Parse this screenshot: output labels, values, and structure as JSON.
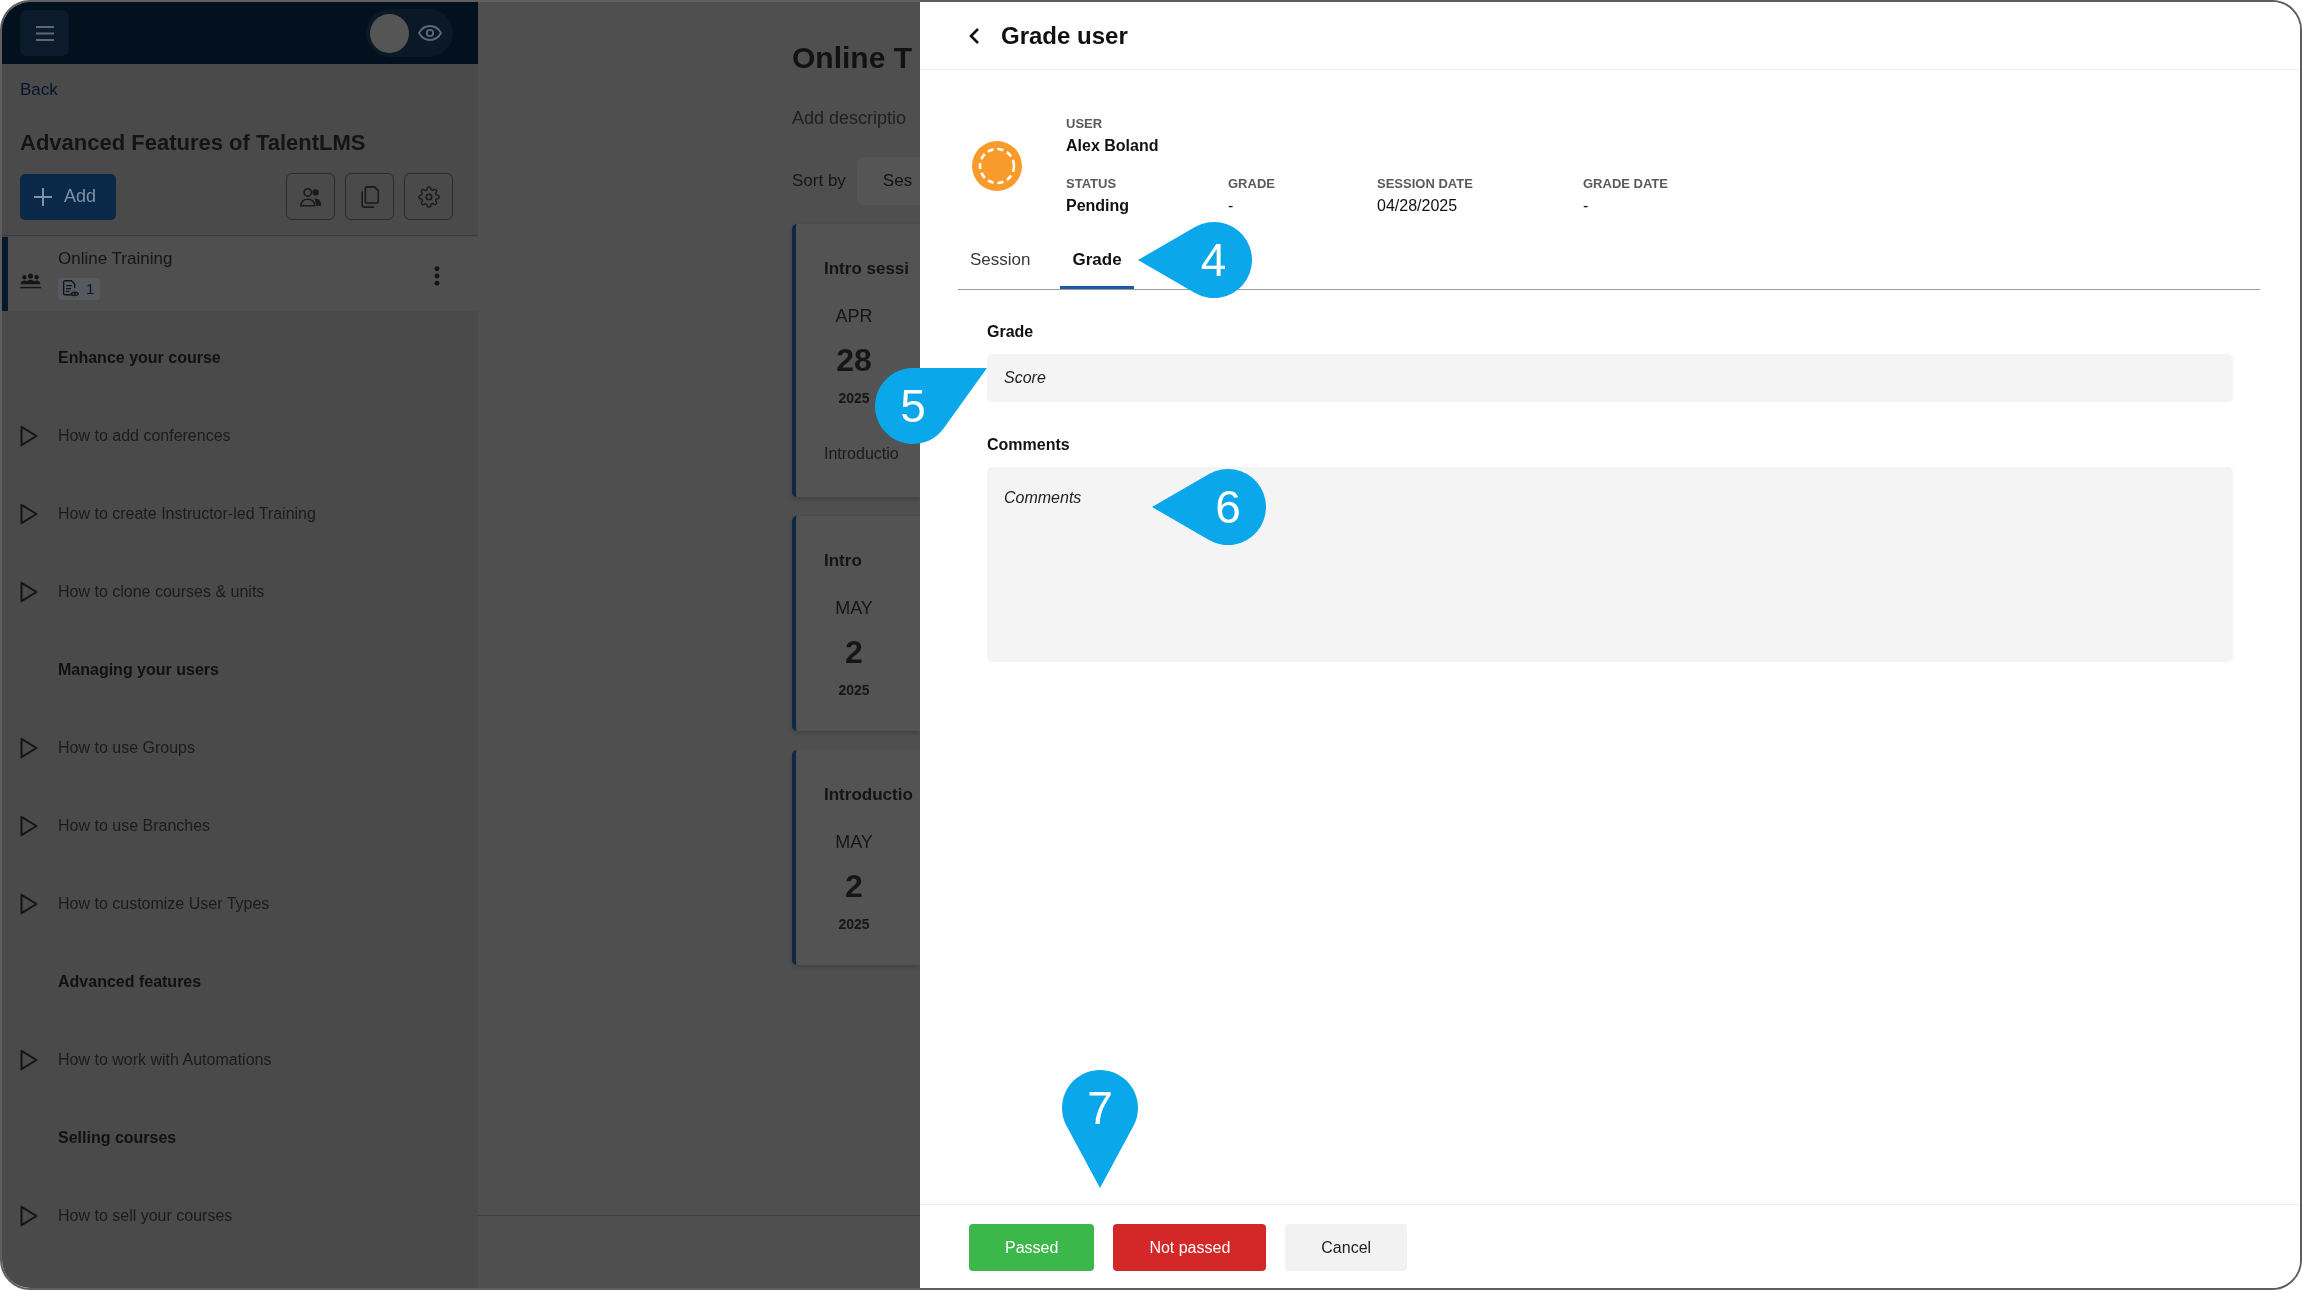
{
  "sidebar": {
    "preview_toggle": {
      "on": false
    },
    "back": "Back",
    "course_title": "Advanced Features of TalentLMS",
    "add_label": "Add",
    "units": [
      {
        "kind": "training",
        "title": "Online Training",
        "badge": "1",
        "selected": true
      },
      {
        "kind": "section",
        "title": "Enhance your course"
      },
      {
        "kind": "video",
        "title": "How to add conferences",
        "selected": false
      },
      {
        "kind": "video",
        "title": "How to create Instructor-led Training",
        "selected": false
      },
      {
        "kind": "video",
        "title": "How to clone courses & units",
        "selected": false
      },
      {
        "kind": "section",
        "title": "Managing your users"
      },
      {
        "kind": "video",
        "title": "How to use Groups",
        "selected": false
      },
      {
        "kind": "video",
        "title": "How to use Branches",
        "selected": false
      },
      {
        "kind": "video",
        "title": "How to customize User Types",
        "selected": false
      },
      {
        "kind": "section",
        "title": "Advanced features"
      },
      {
        "kind": "video",
        "title": "How to work with Automations",
        "selected": false
      },
      {
        "kind": "section",
        "title": "Selling courses"
      },
      {
        "kind": "video",
        "title": "How to sell your courses",
        "selected": false
      }
    ]
  },
  "main": {
    "title": "Online T",
    "description": {
      "placeholder": "Add descriptio"
    },
    "sort": {
      "label": "Sort by",
      "value": "Ses"
    },
    "sessions": [
      {
        "title": "Intro sessi",
        "month": "APR",
        "day": "28",
        "year": "2025",
        "description": "Introductio"
      },
      {
        "title": "Intro",
        "month": "MAY",
        "day": "2",
        "year": "2025"
      },
      {
        "title": "Introductio",
        "month": "MAY",
        "day": "2",
        "year": "2025"
      }
    ]
  },
  "drawer": {
    "title": "Grade user",
    "user": {
      "label": "USER",
      "name": "Alex Boland"
    },
    "fields": [
      {
        "kind": "status",
        "label": "STATUS",
        "value": "Pending"
      },
      {
        "kind": "grade",
        "label": "GRADE",
        "value": "-"
      },
      {
        "kind": "date",
        "label": "SESSION DATE",
        "value": "04/28/2025"
      },
      {
        "kind": "date",
        "label": "GRADE DATE",
        "value": "-"
      }
    ],
    "tabs": [
      {
        "label": "Session",
        "selected": false
      },
      {
        "label": "Grade",
        "selected": true,
        "callout": "4"
      }
    ],
    "form": [
      {
        "kind": "input",
        "label": "Grade",
        "placeholder": "Score",
        "callout": "5"
      },
      {
        "kind": "textarea",
        "label": "Comments",
        "placeholder": "Comments",
        "callout": "6"
      }
    ],
    "actions": [
      {
        "kind": "success",
        "label": "Passed",
        "callout": "7"
      },
      {
        "kind": "danger",
        "label": "Not passed"
      },
      {
        "kind": "neutral",
        "label": "Cancel"
      }
    ]
  }
}
